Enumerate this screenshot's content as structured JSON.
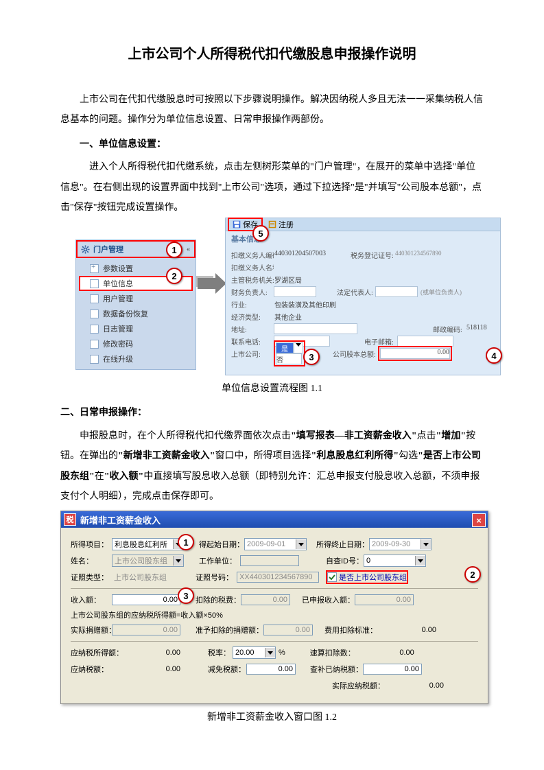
{
  "title": "上市公司个人所得税代扣代缴股息申报操作说明",
  "intro": "上市公司在代扣代缴股息时可按照以下步骤说明操作。解决因纳税人多且无法一一采集纳税人信息基本的问题。操作分为单位信息设置、日常申报操作两部份。",
  "section1": {
    "heading": "一、单位信息设置：",
    "p1a": "进入个人所得税代扣代缴系统，点击左侧树形菜单的",
    "p1b": "\"门户管理\"",
    "p1c": "，在展开的菜单中选择",
    "p1d": "\"单位信息\"",
    "p1e": "。在右侧出现的设置界面中找到",
    "p1f": "\"上市公司\"",
    "p1g": "选项，通过下拉选择",
    "p1h": "\"是\"",
    "p1i": "并填写",
    "p1j": "\"公司股本总额\"",
    "p1k": "，点击",
    "p1l": "\"保存\"",
    "p1m": "按钮完成设置操作。"
  },
  "fig1": {
    "sidebar_title": "门户管理",
    "items": [
      "参数设置",
      "单位信息",
      "用户管理",
      "数据备份恢复",
      "日志管理",
      "修改密码",
      "在线升级"
    ],
    "toolbar": {
      "save": "保存",
      "register": "注册"
    },
    "subtab": "基本信息",
    "form": {
      "l1": "扣缴义务人编码:",
      "v1": "440301204507003",
      "l1b": "税务登记证号:",
      "v1b": "440301234567890",
      "l2": "扣缴义务人名称:",
      "v2": "",
      "l3": "主管税务机关:",
      "v3": "罗湖区局",
      "l4": "财务负责人:",
      "l4b": "法定代表人:",
      "hint": "(或单位负责人)",
      "l5": "行业:",
      "v5": "包装装潢及其他印刷",
      "l6": "经济类型:",
      "v6": "其他企业",
      "l7": "地址:",
      "l7b": "邮政编码:",
      "v7b": "518118",
      "l8": "联系电话:",
      "l8b": "电子邮箱:",
      "l9": "上市公司:",
      "v9": "是",
      "v9b": "否",
      "l9b": "公司股本总额:",
      "v9c": "0.00"
    },
    "caption": "单位信息设置流程图 1.1"
  },
  "section2": {
    "heading": "二、日常申报操作：",
    "p1a": "申报股息时，在个人所得税代扣代缴界面依次点击",
    "p1b": "\"填写报表—非工资薪金收入\"",
    "p1c": "点击",
    "p1d": "\"增加\"",
    "p1e": "按钮。在弹出的",
    "p1f": "\"新增非工资薪金收入\"",
    "p1g": "窗口中，所得项目选择",
    "p1h": "\"利息股息红利所得\"",
    "p1i": "勾选",
    "p1j": "\"是否上市公司股东组\"",
    "p1k": "在",
    "p1l": "\"收入额\"",
    "p1m": "中直接填写股息收入总额（即特别允许：汇总申报支付股息收入总额，不须申报支付个人明细），完成点击保存即可。"
  },
  "fig2": {
    "title": "新增非工资薪金收入",
    "r1l1": "所得项目：",
    "r1v1": "利息股息红利所",
    "r1l2": "得起始日期：",
    "r1v2": "2009-09-01",
    "r1l3": "所得终止日期：",
    "r1v3": "2009-09-30",
    "r2l1": "姓名：",
    "r2v1": "上市公司股东组",
    "r2l2": "工作单位：",
    "r2l3": "自查ID号：",
    "r2v3": "0",
    "r3l1": "证照类型：",
    "r3v1": "上市公司股东组",
    "r3l2": "证照号码：",
    "r3v2": "XX440301234567890",
    "r3cb": "是否上市公司股东组",
    "r4l1": "收入额：",
    "r4v1": "0.00",
    "r4l2": "扣除的税费：",
    "r4v2": "0.00",
    "r4l3": "已申报收入额：",
    "r4v3": "0.00",
    "note": "上市公司股东组的应纳税所得额=收入额×50%",
    "r5l1": "实际捐赠额：",
    "r5v1": "0.00",
    "r5l2": "准予扣除的捐赠额：",
    "r5v2": "0.00",
    "r5l3": "费用扣除标准：",
    "r5v3": "0.00",
    "r6l1": "应纳税所得额：",
    "r6v1": "0.00",
    "r6l2": "税率：",
    "r6v2": "20.00",
    "r6u": "%",
    "r6l3": "速算扣除数：",
    "r6v3": "0.00",
    "r7l1": "应纳税额：",
    "r7v1": "0.00",
    "r7l2": "减免税额：",
    "r7v2": "0.00",
    "r7l3": "查补已纳税额：",
    "r7v3": "0.00",
    "r8l3": "实际应纳税额：",
    "r8v3": "0.00",
    "caption": "新增非工资薪金收入窗口图 1.2"
  }
}
